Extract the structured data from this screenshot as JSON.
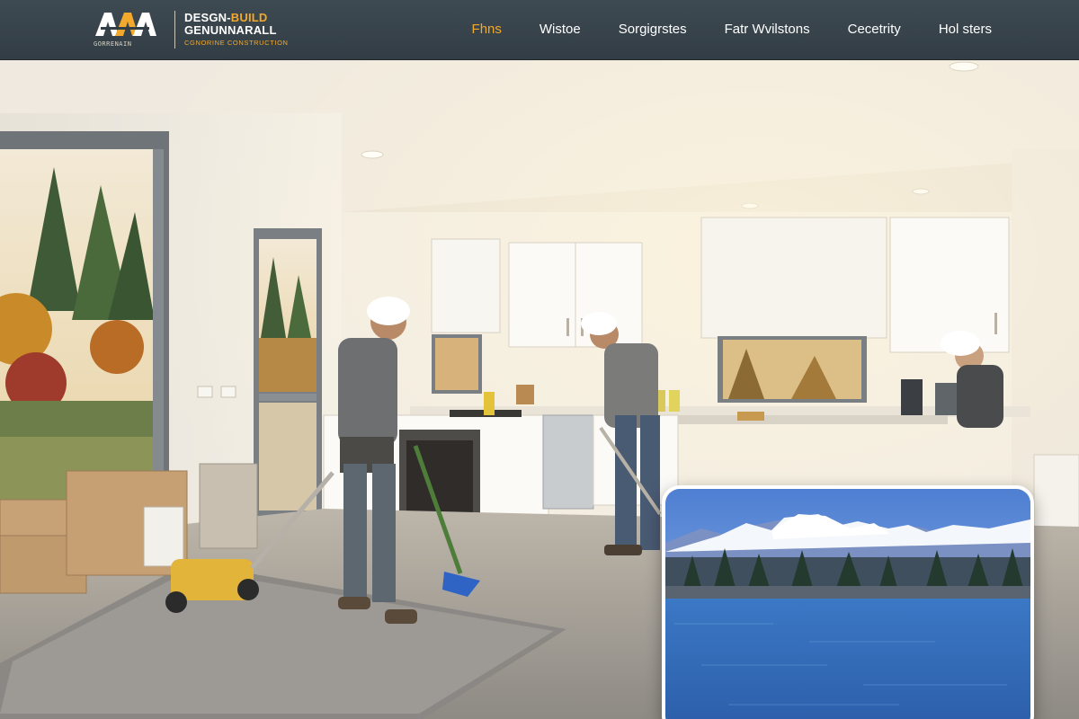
{
  "brand": {
    "logo_letters": "AAA",
    "logo_caption": "GORRENAIN",
    "line1_prefix": "DESGN-",
    "line1_accent": "BUILD",
    "line2": "GENUNNARALL",
    "line3": "CGNORINE CONSTRUCTION"
  },
  "nav": {
    "items": [
      {
        "label": "Fhns",
        "active": true
      },
      {
        "label": "Wistoe",
        "active": false
      },
      {
        "label": "Sorgigrstes",
        "active": false
      },
      {
        "label": "Fatr Wvilstons",
        "active": false
      },
      {
        "label": "Cecetrity",
        "active": false
      },
      {
        "label": "Hol sters",
        "active": false
      }
    ]
  },
  "hero": {
    "scene": "kitchen-renovation-photo",
    "inset": "lake-mountain-photo"
  },
  "colors": {
    "header_bg": "#3a464e",
    "accent": "#f3a92b",
    "nav_text": "#ffffff"
  }
}
